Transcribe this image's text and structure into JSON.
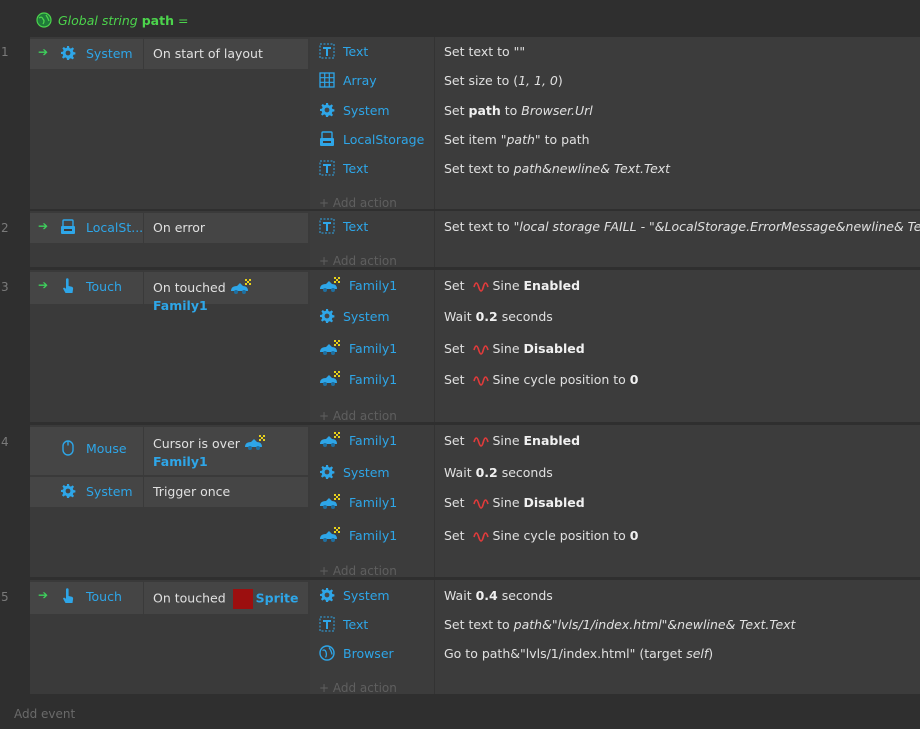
{
  "global": {
    "prefix": "Global string",
    "name": "path",
    "suffix": "="
  },
  "add_event": "Add event",
  "add_action": "+ Add action",
  "events": [
    {
      "num": "1",
      "conditions": [
        {
          "object": "System",
          "icon": "gear-icon",
          "text": "On start of layout"
        }
      ],
      "actions": [
        {
          "object": "Text",
          "icon": "text-icon",
          "parts": [
            [
              "Set text to \"\"",
              ""
            ]
          ]
        },
        {
          "object": "Array",
          "icon": "array-icon",
          "parts": [
            [
              "Set size to (",
              ""
            ],
            [
              "1, 1, 0",
              "i"
            ],
            [
              ")",
              ""
            ]
          ]
        },
        {
          "object": "System",
          "icon": "gear-icon",
          "parts": [
            [
              "Set ",
              ""
            ],
            [
              "path",
              "b"
            ],
            [
              " to ",
              ""
            ],
            [
              "Browser.Url",
              "i"
            ]
          ]
        },
        {
          "object": "LocalStorage",
          "icon": "local-storage-icon",
          "parts": [
            [
              "Set item ",
              ""
            ],
            [
              "\"path\"",
              "i"
            ],
            [
              " to path",
              ""
            ]
          ]
        },
        {
          "object": "Text",
          "icon": "text-icon",
          "parts": [
            [
              "Set text to ",
              ""
            ],
            [
              "path&newline& Text.Text",
              "i"
            ]
          ]
        }
      ]
    },
    {
      "num": "2",
      "conditions": [
        {
          "object": "LocalSt...",
          "icon": "local-storage-icon",
          "text": "On error"
        }
      ],
      "actions": [
        {
          "object": "Text",
          "icon": "text-icon",
          "parts": [
            [
              "Set text to ",
              ""
            ],
            [
              "\"local storage FAILL - \"&LocalStorage.ErrorMessage&newline& Text.Text",
              "i"
            ]
          ]
        }
      ]
    },
    {
      "num": "3",
      "conditions": [
        {
          "object": "Touch",
          "icon": "touch-icon",
          "text": "On touched",
          "family": "Family1"
        }
      ],
      "actions": [
        {
          "object": "Family1",
          "icon": "family-icon",
          "parts": [
            [
              "Set ",
              ""
            ],
            [
              "SINE",
              "s"
            ],
            [
              "Sine ",
              ""
            ],
            [
              "Enabled",
              "b"
            ]
          ]
        },
        {
          "object": "System",
          "icon": "gear-icon",
          "parts": [
            [
              "Wait ",
              ""
            ],
            [
              "0.2",
              "b"
            ],
            [
              " seconds",
              ""
            ]
          ]
        },
        {
          "object": "Family1",
          "icon": "family-icon",
          "parts": [
            [
              "Set ",
              ""
            ],
            [
              "SINE",
              "s"
            ],
            [
              "Sine ",
              ""
            ],
            [
              "Disabled",
              "b"
            ]
          ]
        },
        {
          "object": "Family1",
          "icon": "family-icon",
          "parts": [
            [
              "Set ",
              ""
            ],
            [
              "SINE",
              "s"
            ],
            [
              "Sine cycle position to ",
              ""
            ],
            [
              "0",
              "b"
            ]
          ]
        }
      ]
    },
    {
      "num": "4",
      "conditions": [
        {
          "object": "Mouse",
          "icon": "mouse-icon",
          "text": "Cursor is over",
          "family": "Family1",
          "wrap": true
        },
        {
          "object": "System",
          "icon": "gear-icon",
          "text": "Trigger once"
        }
      ],
      "actions": [
        {
          "object": "Family1",
          "icon": "family-icon",
          "parts": [
            [
              "Set ",
              ""
            ],
            [
              "SINE",
              "s"
            ],
            [
              "Sine ",
              ""
            ],
            [
              "Enabled",
              "b"
            ]
          ]
        },
        {
          "object": "System",
          "icon": "gear-icon",
          "parts": [
            [
              "Wait ",
              ""
            ],
            [
              "0.2",
              "b"
            ],
            [
              " seconds",
              ""
            ]
          ]
        },
        {
          "object": "Family1",
          "icon": "family-icon",
          "parts": [
            [
              "Set ",
              ""
            ],
            [
              "SINE",
              "s"
            ],
            [
              "Sine ",
              ""
            ],
            [
              "Disabled",
              "b"
            ]
          ]
        },
        {
          "object": "Family1",
          "icon": "family-icon",
          "parts": [
            [
              "Set ",
              ""
            ],
            [
              "SINE",
              "s"
            ],
            [
              "Sine cycle position to ",
              ""
            ],
            [
              "0",
              "b"
            ]
          ]
        }
      ]
    },
    {
      "num": "5",
      "conditions": [
        {
          "object": "Touch",
          "icon": "touch-icon",
          "text": "On touched",
          "sprite": "Sprite"
        }
      ],
      "actions": [
        {
          "object": "System",
          "icon": "gear-icon",
          "parts": [
            [
              "Wait ",
              ""
            ],
            [
              "0.4",
              "b"
            ],
            [
              " seconds",
              ""
            ]
          ]
        },
        {
          "object": "Text",
          "icon": "text-icon",
          "parts": [
            [
              "Set text to ",
              ""
            ],
            [
              "path&\"lvls/1/index.html\"&newline& Text.Text",
              "i"
            ]
          ]
        },
        {
          "object": "Browser",
          "icon": "globe-icon",
          "parts": [
            [
              "Go to path&\"lvls/1/index.html\" (target ",
              ""
            ],
            [
              "self",
              "i"
            ],
            [
              ")",
              ""
            ]
          ]
        }
      ]
    }
  ],
  "colors": {
    "accent": "#2ea6e8",
    "global": "#4cd44c",
    "trigger_arrow": "#3ecf5c",
    "sine": "#e23b3b",
    "sprite": "#9c0f0f"
  }
}
